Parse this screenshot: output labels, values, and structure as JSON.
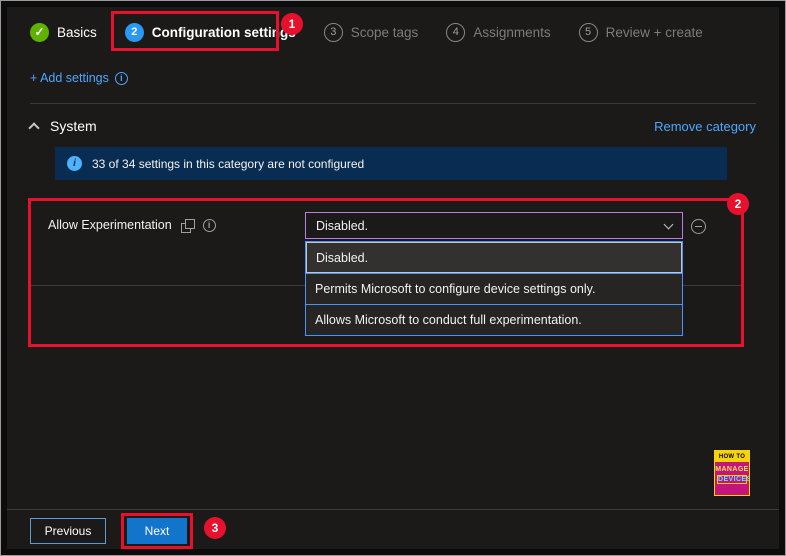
{
  "wizard": {
    "tabs": [
      {
        "label": "Basics",
        "badge": "",
        "state": "done"
      },
      {
        "label": "Configuration settings",
        "badge": "2",
        "state": "active"
      },
      {
        "label": "Scope tags",
        "badge": "3",
        "state": "upcoming"
      },
      {
        "label": "Assignments",
        "badge": "4",
        "state": "upcoming"
      },
      {
        "label": "Review + create",
        "badge": "5",
        "state": "upcoming"
      }
    ]
  },
  "toolbar": {
    "add_settings_label": "+ Add settings"
  },
  "category": {
    "title": "System",
    "remove_label": "Remove category",
    "banner_text": "33 of 34 settings in this category are not configured"
  },
  "setting": {
    "label": "Allow Experimentation",
    "value": "Disabled.",
    "options": [
      "Disabled.",
      "Permits Microsoft to configure device settings only.",
      "Allows Microsoft to conduct full experimentation."
    ]
  },
  "footer": {
    "previous_label": "Previous",
    "next_label": "Next"
  },
  "annotations": {
    "one": "1",
    "two": "2",
    "three": "3"
  },
  "logo": {
    "line1": "HOW TO",
    "line2": "MANAGE",
    "line3": "DEVICES"
  },
  "icons": {
    "check": "✓",
    "info": "i"
  },
  "colors": {
    "background": "#1b1a19",
    "accent_link": "#4da6ff",
    "annotation_red": "#e8112d",
    "step_done_green": "#5db300",
    "step_active_blue": "#2899f5",
    "banner_background": "#092d52",
    "dropdown_border_purple": "#b87ee5",
    "dropdown_list_border_blue": "#4894fe",
    "next_button_blue": "#1374cc"
  }
}
